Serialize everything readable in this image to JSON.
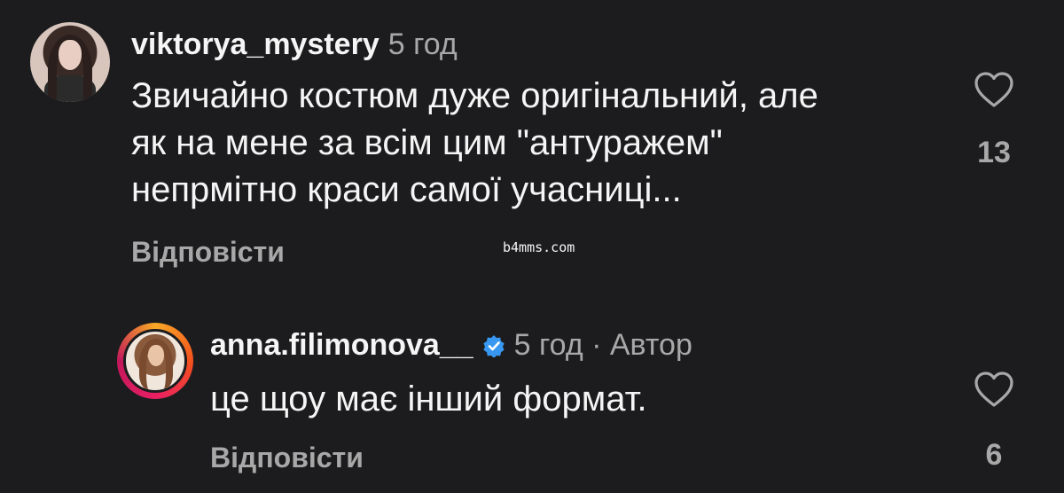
{
  "comments": [
    {
      "username": "viktorya_mystery",
      "time": "5 год",
      "text_lines": [
        "Звичайно костюм дуже оригінальний, але",
        "як на мене за всім цим \"антуражем\"",
        "непрмітно краси самої учасниці..."
      ],
      "reply_label": "Відповісти",
      "like_count": "13",
      "like_icon": "heart-outline-icon"
    },
    {
      "username": "anna.filimonova__",
      "verified_icon": "verified-badge-icon",
      "meta": "5 год · Автор",
      "text": "це щоу має інший формат.",
      "reply_label": "Відповісти",
      "like_count": "6",
      "like_icon": "heart-outline-icon"
    }
  ],
  "watermark": "b4mms.com",
  "colors": {
    "background": "#1c1c1e",
    "text_primary": "#f5f5f5",
    "text_secondary": "#a8a8a8",
    "verified_blue": "#3897f0"
  }
}
